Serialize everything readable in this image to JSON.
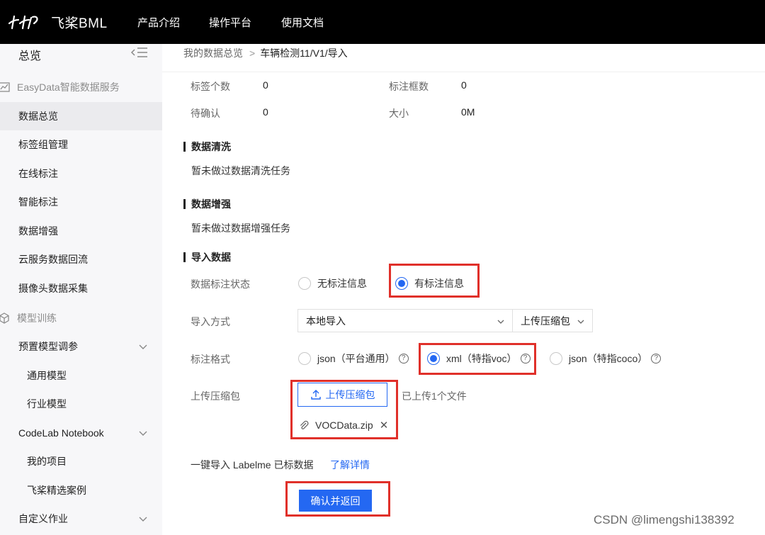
{
  "topbar": {
    "logo_text": "飞桨BML",
    "nav": [
      "产品介绍",
      "操作平台",
      "使用文档"
    ]
  },
  "sidebar": {
    "title": "总览",
    "groups": [
      {
        "label": "EasyData智能数据服务",
        "icon": "chart-line-icon"
      },
      {
        "label": "模型训练",
        "icon": "cube-icon"
      }
    ],
    "items": [
      {
        "label": "数据总览",
        "active": true
      },
      {
        "label": "标签组管理"
      },
      {
        "label": "在线标注"
      },
      {
        "label": "智能标注"
      },
      {
        "label": "数据增强"
      },
      {
        "label": "云服务数据回流"
      },
      {
        "label": "摄像头数据采集"
      },
      {
        "label": "预置模型调参"
      },
      {
        "label": "通用模型"
      },
      {
        "label": "行业模型"
      },
      {
        "label": "CodeLab Notebook"
      },
      {
        "label": "我的项目"
      },
      {
        "label": "飞桨精选案例"
      },
      {
        "label": "自定义作业"
      }
    ]
  },
  "breadcrumb": {
    "parent": "我的数据总览",
    "separator": ">",
    "current": "车辆检测11/V1/导入"
  },
  "stats": {
    "label_count_label": "标签个数",
    "label_count": "0",
    "box_count_label": "标注框数",
    "box_count": "0",
    "pending_label": "待确认",
    "pending": "0",
    "size_label": "大小",
    "size": "0M"
  },
  "cleaning": {
    "title": "数据清洗",
    "text": "暂未做过数据清洗任务"
  },
  "augment": {
    "title": "数据增强",
    "text": "暂未做过数据增强任务"
  },
  "import": {
    "title": "导入数据",
    "status_label": "数据标注状态",
    "status_options": [
      "无标注信息",
      "有标注信息"
    ],
    "method_label": "导入方式",
    "method_value": "本地导入",
    "method_sub_value": "上传压缩包",
    "format_label": "标注格式",
    "format_options": [
      "json（平台通用）",
      "xml（特指voc）",
      "json（特指coco）"
    ],
    "upload_label": "上传压缩包",
    "upload_button": "上传压缩包",
    "upload_note": "已上传1个文件",
    "file_name": "VOCData.zip",
    "one_key_text": "一键导入 Labelme 已标数据",
    "learn_more": "了解详情",
    "confirm_button": "确认并返回"
  },
  "colors": {
    "accent": "#2468f2",
    "highlight": "#e0302a",
    "topbar": "#000000"
  },
  "watermark": "CSDN @limengshi138392"
}
